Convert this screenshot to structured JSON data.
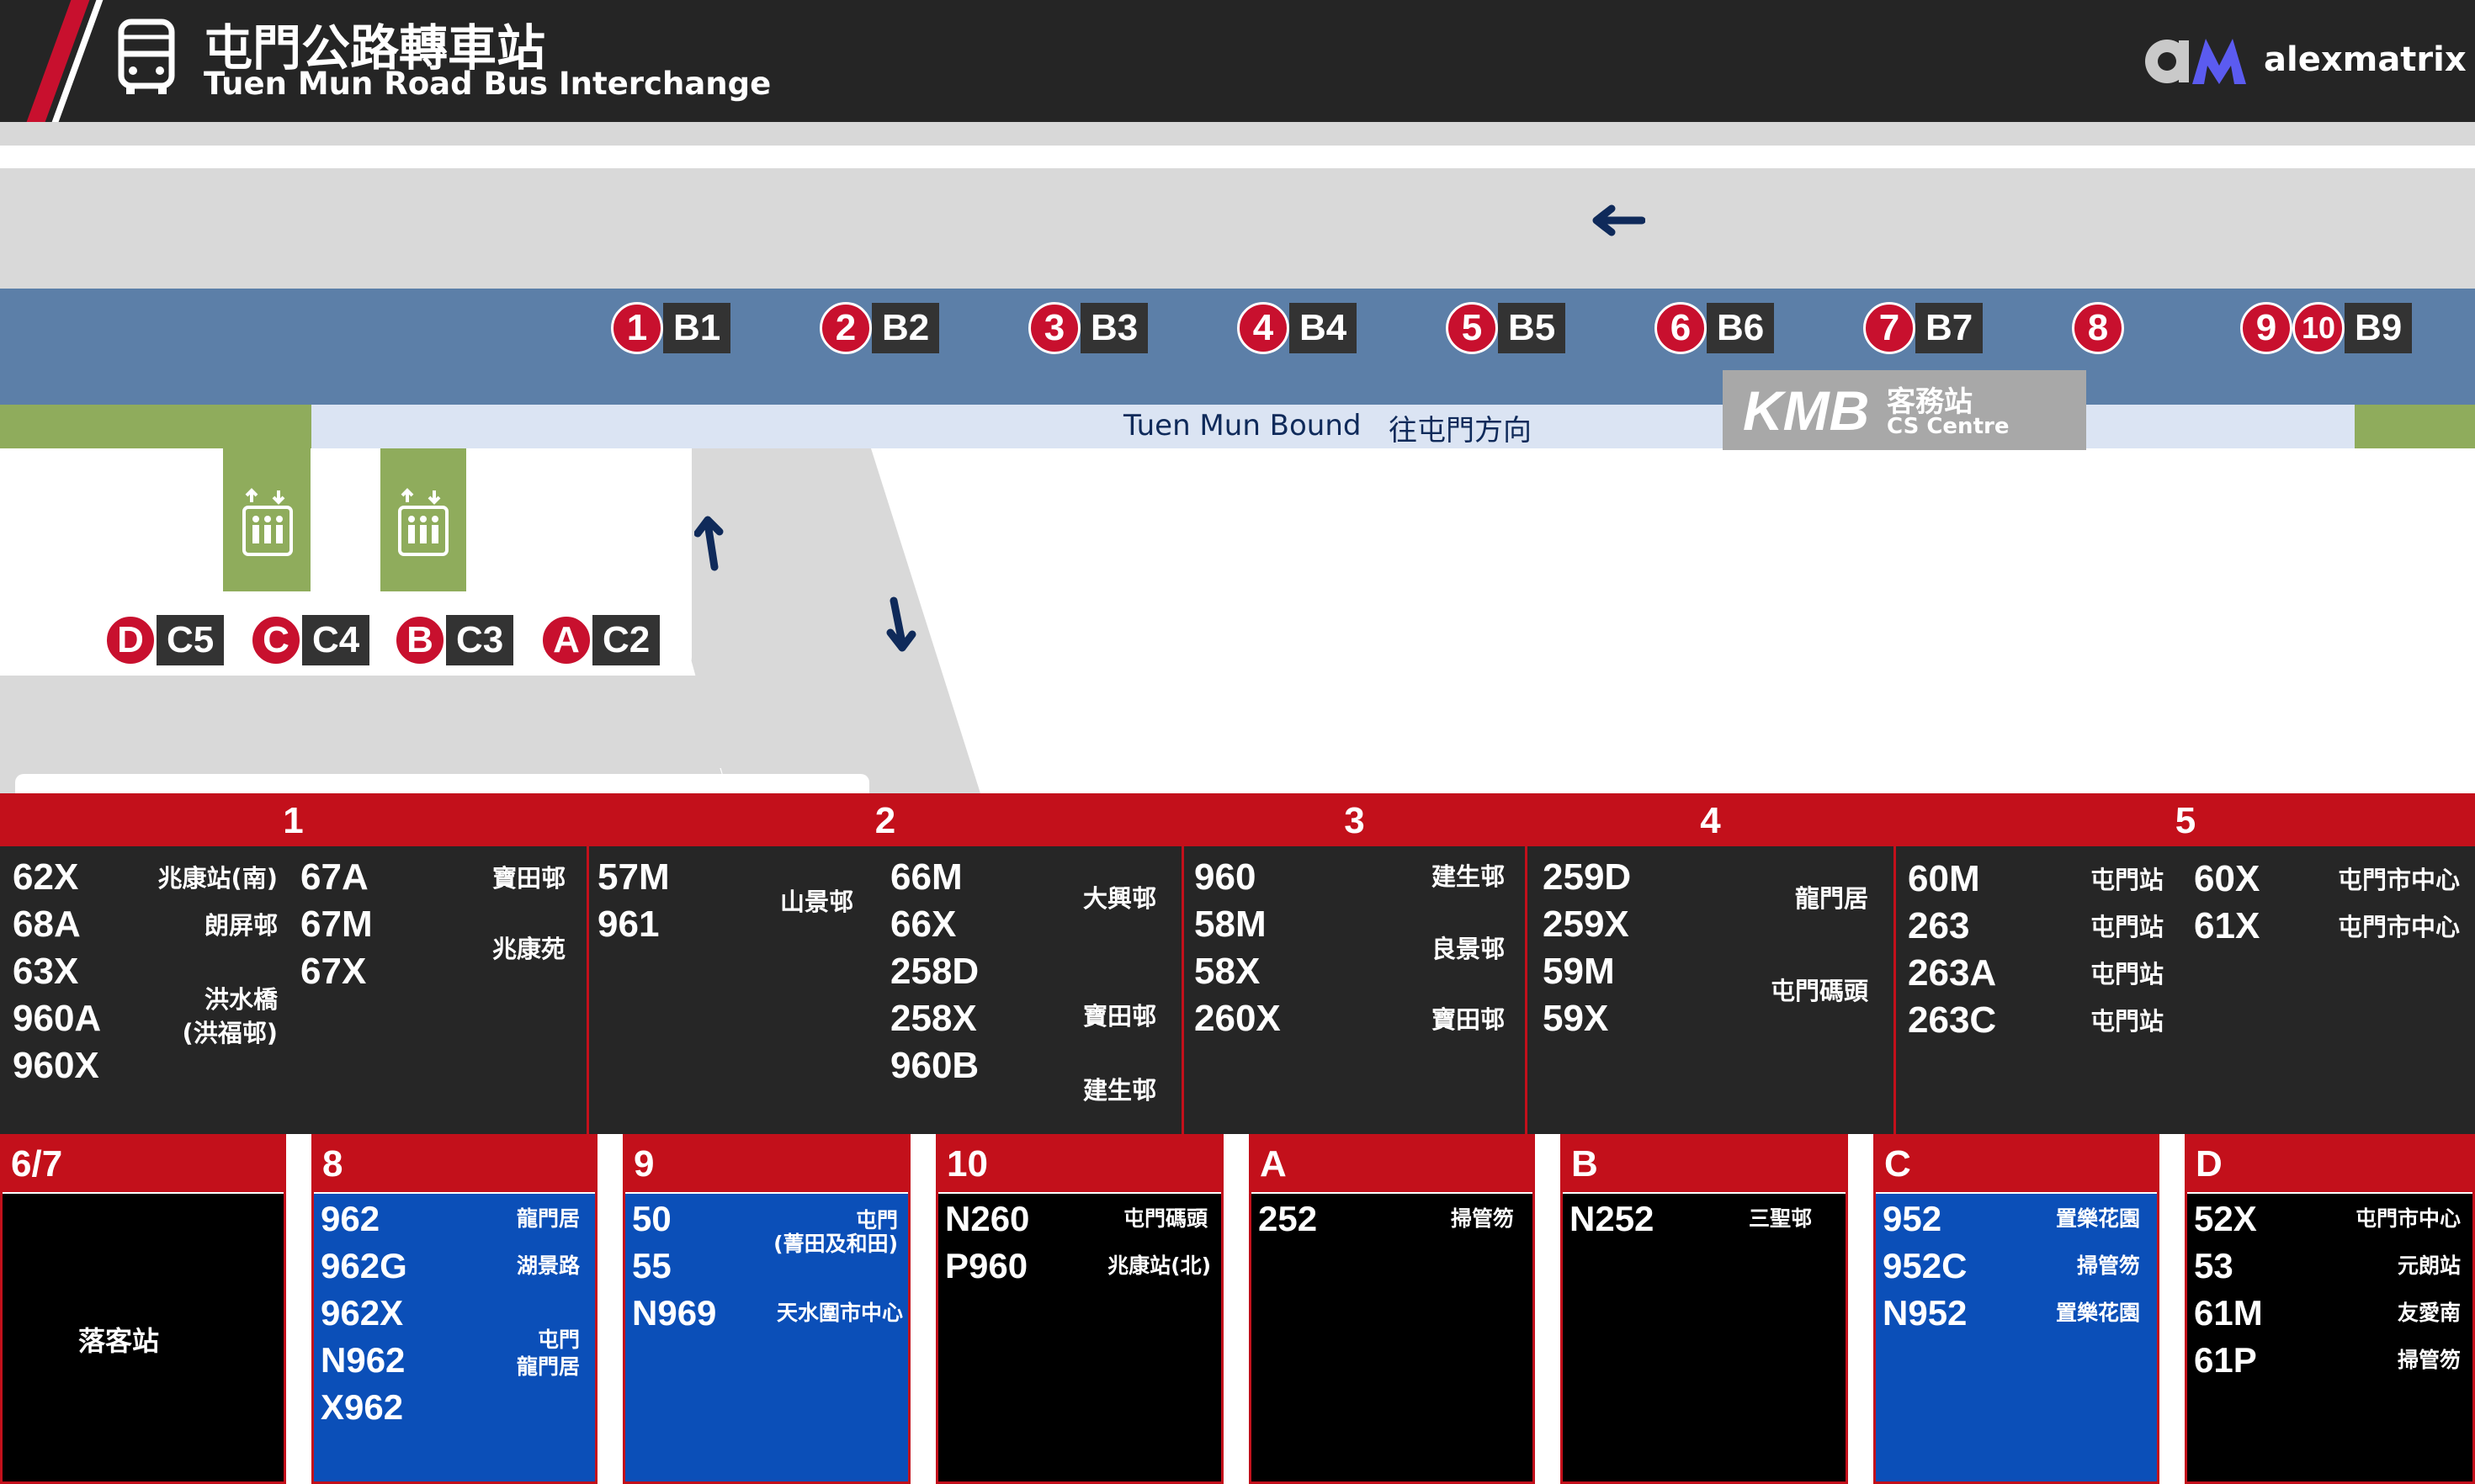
{
  "header": {
    "title_zh": "屯門公路轉車站",
    "title_en": "Tuen Mun Road Bus Interchange",
    "brand": "alexmatrix"
  },
  "colors": {
    "red": "#c8102e",
    "dark": "#252525",
    "blue": "#0b4fb8",
    "road": "#d9d9d9",
    "platform": "#5c7fa8",
    "green": "#8fac5c"
  },
  "map": {
    "bound_en": "Tuen Mun Bound",
    "bound_zh": "往屯門方向",
    "kmb_logo": "KMB",
    "cs_zh": "客務站",
    "cs_en": "CS Centre",
    "bays": [
      {
        "num": "1",
        "code": "B1"
      },
      {
        "num": "2",
        "code": "B2"
      },
      {
        "num": "3",
        "code": "B3"
      },
      {
        "num": "4",
        "code": "B4"
      },
      {
        "num": "5",
        "code": "B5"
      },
      {
        "num": "6",
        "code": "B6"
      },
      {
        "num": "7",
        "code": "B7"
      },
      {
        "num": "8",
        "code": ""
      },
      {
        "num": "9",
        "code": ""
      },
      {
        "num": "10",
        "code": "B9"
      }
    ],
    "cbays": [
      {
        "letter": "D",
        "code": "C5"
      },
      {
        "letter": "C",
        "code": "C4"
      },
      {
        "letter": "B",
        "code": "C3"
      },
      {
        "letter": "A",
        "code": "C2"
      }
    ]
  },
  "upper": {
    "p1": {
      "label": "1",
      "routes": [
        "62X",
        "68A",
        "63X",
        "960A",
        "960X",
        "67A",
        "67M",
        "67X"
      ],
      "dests": [
        "兆康站(南)",
        "朗屏邨",
        "洪水橋",
        "(洪福邨)",
        "寶田邨",
        "兆康苑"
      ]
    },
    "p2": {
      "label": "2",
      "routes": [
        "57M",
        "961",
        "66M",
        "66X",
        "258D",
        "258X",
        "960B"
      ],
      "dests": [
        "山景邨",
        "大興邨",
        "寶田邨",
        "建生邨"
      ]
    },
    "p3": {
      "label": "3",
      "routes": [
        "960",
        "58M",
        "58X",
        "260X"
      ],
      "dests": [
        "建生邨",
        "良景邨",
        "寶田邨"
      ]
    },
    "p4": {
      "label": "4",
      "routes": [
        "259D",
        "259X",
        "59M",
        "59X"
      ],
      "dests": [
        "龍門居",
        "屯門碼頭"
      ]
    },
    "p5": {
      "label": "5",
      "routes": [
        "60M",
        "263",
        "263A",
        "263C",
        "60X",
        "61X"
      ],
      "dests": [
        "屯門站",
        "屯門站",
        "屯門站",
        "屯門站",
        "屯門市中心",
        "屯門市中心"
      ]
    }
  },
  "lower": {
    "p67": {
      "label": "6/7",
      "note": "落客站"
    },
    "p8": {
      "label": "8",
      "routes": [
        "962",
        "962G",
        "962X",
        "N962",
        "X962"
      ],
      "dests": [
        "龍門居",
        "湖景路",
        "屯門",
        "龍門居"
      ]
    },
    "p9": {
      "label": "9",
      "routes": [
        "50",
        "55",
        "N969"
      ],
      "dests": [
        "屯門",
        "(菁田及和田)",
        "天水圍市中心"
      ]
    },
    "p10": {
      "label": "10",
      "routes": [
        "N260",
        "P960"
      ],
      "dests": [
        "屯門碼頭",
        "兆康站(北)"
      ]
    },
    "pA": {
      "label": "A",
      "routes": [
        "252"
      ],
      "dests": [
        "掃管笏"
      ]
    },
    "pB": {
      "label": "B",
      "routes": [
        "N252"
      ],
      "dests": [
        "三聖邨"
      ]
    },
    "pC": {
      "label": "C",
      "routes": [
        "952",
        "952C",
        "N952"
      ],
      "dests": [
        "置樂花園",
        "掃管笏",
        "置樂花園"
      ]
    },
    "pD": {
      "label": "D",
      "routes": [
        "52X",
        "53",
        "61M",
        "61P"
      ],
      "dests": [
        "屯門市中心",
        "元朗站",
        "友愛南",
        "掃管笏"
      ]
    }
  }
}
